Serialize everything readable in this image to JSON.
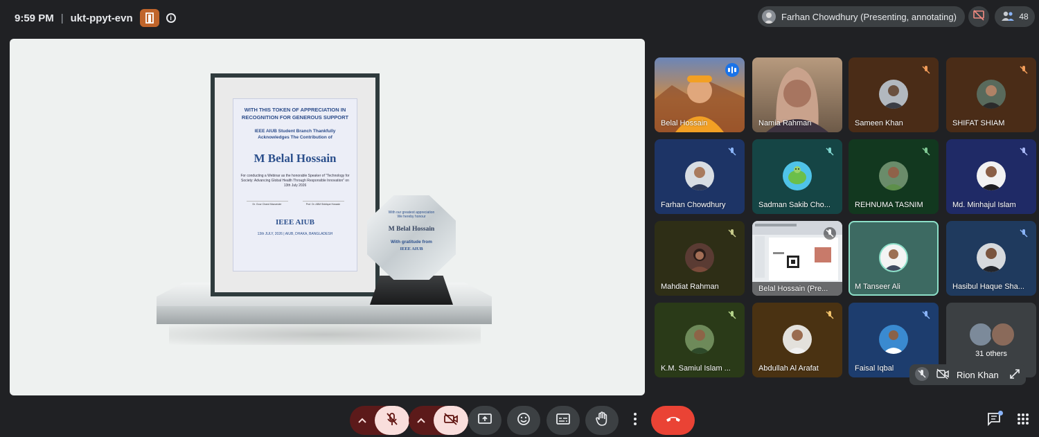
{
  "header": {
    "time": "9:59 PM",
    "separator": "|",
    "meeting_code": "ukt-ppyt-evn",
    "presenter_status": "Farhan Chowdhury (Presenting, annotating)",
    "participant_count": "48"
  },
  "presentation": {
    "certificate": {
      "heading": "WITH THIS TOKEN OF APPRECIATION IN RECOGNITION FOR GENEROUS SUPPORT",
      "acknowledgement": "IEEE AIUB Student Branch Thankfully Acknowledges The Contribution of",
      "recipient": "M Belal Hossain",
      "description": "For conducting a Webinar as the honorable Speaker of \"Technology for Society: Advancing Global Health Through Responsible Innovation\" on 13th July 2026",
      "signatory_1": "Dr. Gour Chand Mazumder",
      "signatory_2": "Prof. Dr. ABM Siddique Hossain",
      "logo_text": "IEEE AIUB",
      "footer": "13th JULY, 2026 | AIUB, DHAKA, BANGLADESH"
    },
    "trophy": {
      "line1": "With our greatest appreciation",
      "line2": "We hereby honour",
      "recipient": "M Belal Hossain",
      "gratitude": "With gratitude from",
      "logo_text": "IEEE AIUB"
    }
  },
  "participants": [
    {
      "name": "Belal Hossain",
      "status": "speaking"
    },
    {
      "name": "Namia Rahman",
      "status": "video"
    },
    {
      "name": "Sameen Khan",
      "status": "muted"
    },
    {
      "name": "SHIFAT SHIAM",
      "status": "muted"
    },
    {
      "name": "Farhan Chowdhury",
      "status": "muted"
    },
    {
      "name": "Sadman Sakib Cho...",
      "status": "muted"
    },
    {
      "name": "REHNUMA TASNIM",
      "status": "muted"
    },
    {
      "name": "Md. Minhajul Islam",
      "status": "muted"
    },
    {
      "name": "Mahdiat Rahman",
      "status": "muted"
    },
    {
      "name": "Belal Hossain (Pre...",
      "status": "muted"
    },
    {
      "name": "M Tanseer Ali",
      "status": "active"
    },
    {
      "name": "Hasibul Haque Sha...",
      "status": "muted"
    },
    {
      "name": "K.M. Samiul Islam ...",
      "status": "muted"
    },
    {
      "name": "Abdullah Al Arafat",
      "status": "muted"
    },
    {
      "name": "Faisal Iqbal",
      "status": "muted"
    }
  ],
  "others_label": "31 others",
  "self_view": {
    "name": "Rion Khan"
  },
  "colors": {
    "background": "#202124",
    "surface": "#3c4043",
    "end_call": "#ea4335",
    "muted_control": "#f9dedc",
    "active_outline": "#8ddfc8",
    "speaking": "#1a73e8"
  },
  "icons": {
    "mic": "mic-off-icon",
    "camera": "camera-off-icon",
    "present": "present-screen-icon",
    "reactions": "emoji-icon",
    "captions": "captions-icon",
    "raise_hand": "hand-icon",
    "more": "more-vertical-icon",
    "end_call": "phone-hangup-icon",
    "chat": "chat-icon",
    "activities": "apps-grid-icon"
  }
}
